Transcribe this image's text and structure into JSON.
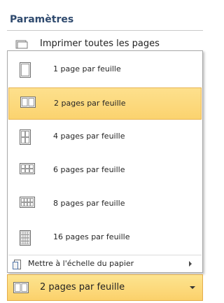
{
  "header": {
    "title": "Paramètres"
  },
  "print_range": {
    "label": "Imprimer toutes les pages",
    "icon": "printer-pages-icon"
  },
  "pages_per_sheet": {
    "options": [
      {
        "label": "1 page par feuille",
        "icon": "one-page-icon"
      },
      {
        "label": "2 pages par feuille",
        "icon": "two-pages-icon"
      },
      {
        "label": "4 pages par feuille",
        "icon": "four-pages-icon"
      },
      {
        "label": "6 pages par feuille",
        "icon": "six-pages-icon"
      },
      {
        "label": "8 pages par feuille",
        "icon": "eight-pages-icon"
      },
      {
        "label": "16 pages par feuille",
        "icon": "sixteen-pages-icon"
      }
    ],
    "selected_label": "2 pages par feuille"
  },
  "scale": {
    "label": "Mettre à l'échelle du papier",
    "icon": "scale-to-paper-icon"
  },
  "colors": {
    "highlight": "#fbd36f",
    "highlight_border": "#e8b452",
    "header_text": "#2f4a6e",
    "border": "#a9a9a9"
  }
}
